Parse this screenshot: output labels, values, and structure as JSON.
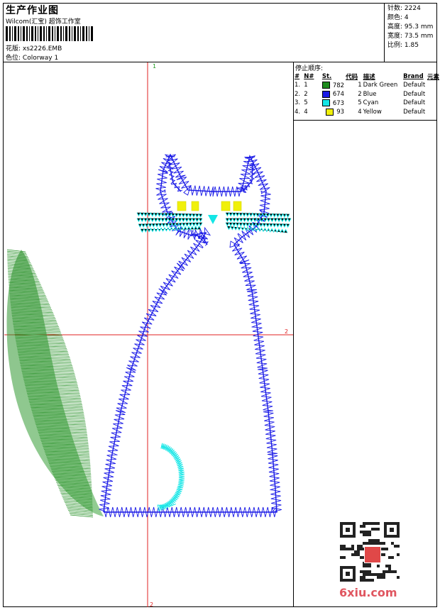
{
  "header": {
    "title": "生产作业图",
    "subtitle": "Wilcom(汇宝) 超饰工作室",
    "design_label": "花版:",
    "design_value": "xs2226.EMB",
    "colorway_label": "色位:",
    "colorway_value": "Colorway 1"
  },
  "stats": [
    {
      "label": "针数:",
      "value": "2224"
    },
    {
      "label": "颜色:",
      "value": "4"
    },
    {
      "label": "高度:",
      "value": "95.3 mm"
    },
    {
      "label": "宽度:",
      "value": "73.5 mm"
    },
    {
      "label": "比例:",
      "value": "1.85"
    }
  ],
  "stop_sequence": {
    "title": "停止顺序:",
    "columns": [
      "#",
      "N#",
      "St.",
      "代码",
      "描述",
      "Brand",
      "元素"
    ],
    "rows": [
      {
        "idx": "1.",
        "n": "1",
        "color": "#1e8c1e",
        "st": "782",
        "code": "1",
        "desc": "Dark Green",
        "brand": "Default"
      },
      {
        "idx": "2.",
        "n": "2",
        "color": "#1a1ae6",
        "st": "674",
        "code": "2",
        "desc": "Blue",
        "brand": "Default"
      },
      {
        "idx": "3.",
        "n": "5",
        "color": "#14e6e6",
        "st": "673",
        "code": "5",
        "desc": "Cyan",
        "brand": "Default"
      },
      {
        "idx": "4.",
        "n": "4",
        "color": "#f0f00a",
        "st": "93",
        "code": "4",
        "desc": "Yellow",
        "brand": "Default"
      }
    ]
  },
  "guides": {
    "top_mark": "1",
    "right_mark": "2",
    "bottom_mark": "2"
  },
  "watermark": {
    "text": "6xiu.com"
  }
}
